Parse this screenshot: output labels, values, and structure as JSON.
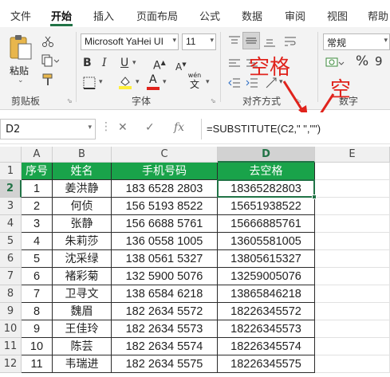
{
  "ribbon_tabs": [
    "文件",
    "开始",
    "插入",
    "页面布局",
    "公式",
    "数据",
    "审阅",
    "视图",
    "帮助"
  ],
  "ribbon": {
    "paste_label": "粘贴",
    "clipboard_label": "剪贴板",
    "font_name": "Microsoft YaHei UI",
    "font_size": "11",
    "font_label": "字体",
    "bold": "B",
    "italic": "I",
    "underline": "U",
    "grow_font": "A",
    "shrink_font": "A",
    "font_color_glyph": "A",
    "phonetic_top": "wén",
    "phonetic_bottom": "文",
    "align_label": "对齐方式",
    "number_format": "常规",
    "percent": "%",
    "comma": "9",
    "number_label": "数字"
  },
  "formula_bar": {
    "name_box": "D2",
    "cancel": "✕",
    "enter": "✓",
    "fx": "fx",
    "formula": "=SUBSTITUTE(C2,\" \",\"\")"
  },
  "annotations": {
    "text_space": "空格",
    "text_empty": "空"
  },
  "sheet": {
    "columns": [
      "A",
      "B",
      "C",
      "D",
      "E"
    ],
    "row_numbers": [
      "1",
      "2",
      "3",
      "4",
      "5",
      "6",
      "7",
      "8",
      "9",
      "10",
      "11",
      "12"
    ],
    "headers": [
      "序号",
      "姓名",
      "手机号码",
      "去空格"
    ],
    "rows": [
      [
        "1",
        "姜洪静",
        "183 6528 2803",
        "18365282803"
      ],
      [
        "2",
        "何侦",
        "156 5193 8522",
        "15651938522"
      ],
      [
        "3",
        "张静",
        "156 6688 5761",
        "15666885761"
      ],
      [
        "4",
        "朱莉莎",
        "136 0558 1005",
        "13605581005"
      ],
      [
        "5",
        "沈采绿",
        "138 0561 5327",
        "13805615327"
      ],
      [
        "6",
        "褚彩菊",
        "132 5900 5076",
        "13259005076"
      ],
      [
        "7",
        "卫寻文",
        "138 6584 6218",
        "13865846218"
      ],
      [
        "8",
        "魏眉",
        "182 2634 5572",
        "18226345572"
      ],
      [
        "9",
        "王佳玲",
        "182 2634 5573",
        "18226345573"
      ],
      [
        "10",
        "陈芸",
        "182 2634 5574",
        "18226345574"
      ],
      [
        "11",
        "韦瑞进",
        "182 2634 5575",
        "18226345575"
      ]
    ]
  },
  "colors": {
    "header_fill": "#19a34a",
    "accent": "#217346",
    "annotation": "#e0231c"
  }
}
